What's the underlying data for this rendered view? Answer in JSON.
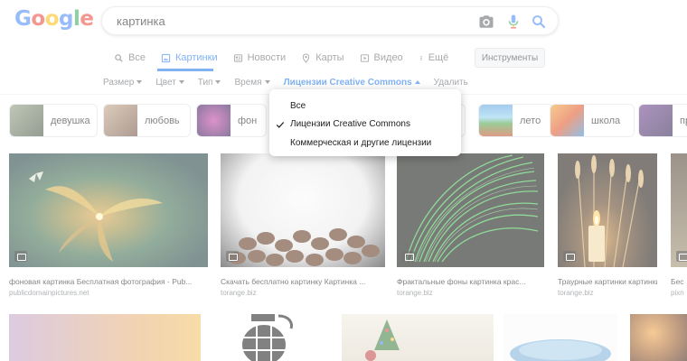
{
  "logo": [
    "G",
    "o",
    "o",
    "g",
    "l",
    "e"
  ],
  "search": {
    "query": "картинка"
  },
  "icons": {
    "camera": "camera-icon",
    "mic": "mic-icon",
    "search": "search-icon",
    "check": "check-icon"
  },
  "tabs": [
    {
      "label": "Все",
      "icon": "search-icon",
      "active": false
    },
    {
      "label": "Картинки",
      "icon": "image-icon",
      "active": true
    },
    {
      "label": "Новости",
      "icon": "news-icon",
      "active": false
    },
    {
      "label": "Карты",
      "icon": "map-pin-icon",
      "active": false
    },
    {
      "label": "Видео",
      "icon": "play-icon",
      "active": false
    },
    {
      "label": "Ещё",
      "icon": "more-vert-icon",
      "active": false
    }
  ],
  "tools_label": "Инструменты",
  "filters": [
    {
      "label": "Размер",
      "caret": true,
      "active": false
    },
    {
      "label": "Цвет",
      "caret": true,
      "active": false
    },
    {
      "label": "Тип",
      "caret": true,
      "active": false
    },
    {
      "label": "Время",
      "caret": true,
      "active": false
    },
    {
      "label": "Лицензии Creative Commons",
      "caret": true,
      "active": true
    },
    {
      "label": "Удалить",
      "caret": false,
      "active": false
    }
  ],
  "chips": [
    {
      "label": "девушка"
    },
    {
      "label": "любовь"
    },
    {
      "label": "фон"
    },
    {
      "label": ""
    },
    {
      "label": ""
    },
    {
      "label": "лето"
    },
    {
      "label": "школа"
    },
    {
      "label": "пр"
    }
  ],
  "results": [
    {
      "title": "фоновая картинка Бесплатная фотография - Pub...",
      "site": "publicdomainpictures.net"
    },
    {
      "title": "Скачать бесплатно картинку Картинка ...",
      "site": "torange.biz"
    },
    {
      "title": "Фрактальные фоны картинка крас...",
      "site": "torange.biz"
    },
    {
      "title": "Траурные картинки картинки ...",
      "site": "torange.biz"
    },
    {
      "title": "Бес",
      "site": "pixn"
    }
  ],
  "license_menu": {
    "items": [
      "Все",
      "Лицензии Creative Commons",
      "Коммерческая и другие лицензии"
    ],
    "selected": "Лицензии Creative Commons"
  },
  "colors": {
    "accent": "#1a73e8",
    "text": "#202124",
    "muted": "#5f6368",
    "site": "#70757a"
  }
}
